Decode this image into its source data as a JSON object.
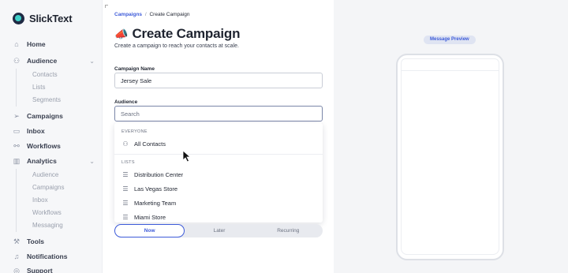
{
  "sidebar": {
    "brand": "SlickText",
    "nav": [
      {
        "label": "Home",
        "icon": "home-icon"
      },
      {
        "label": "Audience",
        "icon": "users-icon"
      },
      {
        "label": "Campaigns",
        "icon": "send-icon"
      },
      {
        "label": "Inbox",
        "icon": "chat-icon"
      },
      {
        "label": "Workflows",
        "icon": "workflow-icon"
      },
      {
        "label": "Analytics",
        "icon": "analytics-icon"
      },
      {
        "label": "Tools",
        "icon": "wrench-icon"
      },
      {
        "label": "Notifications",
        "icon": "bell-icon"
      },
      {
        "label": "Support",
        "icon": "help-icon"
      }
    ],
    "audience_sub": [
      "Contacts",
      "Lists",
      "Segments"
    ],
    "analytics_sub": [
      "Audience",
      "Campaigns",
      "Inbox",
      "Workflows",
      "Messaging"
    ]
  },
  "main": {
    "breadcrumb": {
      "parent": "Campaigns",
      "separator": "/",
      "current": "Create Campaign"
    },
    "title": "Create Campaign",
    "subtitle": "Create a campaign to reach your contacts at scale.",
    "campaign_name_label": "Campaign Name",
    "campaign_name_value": "Jersey Sale",
    "audience_label": "Audience",
    "audience_placeholder": "Search",
    "dropdown": {
      "everyone_header": "EVERYONE",
      "all_contacts": "All Contacts",
      "lists_header": "LISTS",
      "lists": [
        "Distribution Center",
        "Las Vegas Store",
        "Marketing Team",
        "Miami Store"
      ]
    },
    "schedule_tabs": [
      "Now",
      "Later",
      "Recurring"
    ],
    "schedule_selected": "Now"
  },
  "preview": {
    "label": "Message Preview"
  },
  "colors": {
    "accent": "#3d5bd9",
    "sidebar_bg": "#f6f7f9",
    "preview_bg": "#f4f5f7"
  }
}
